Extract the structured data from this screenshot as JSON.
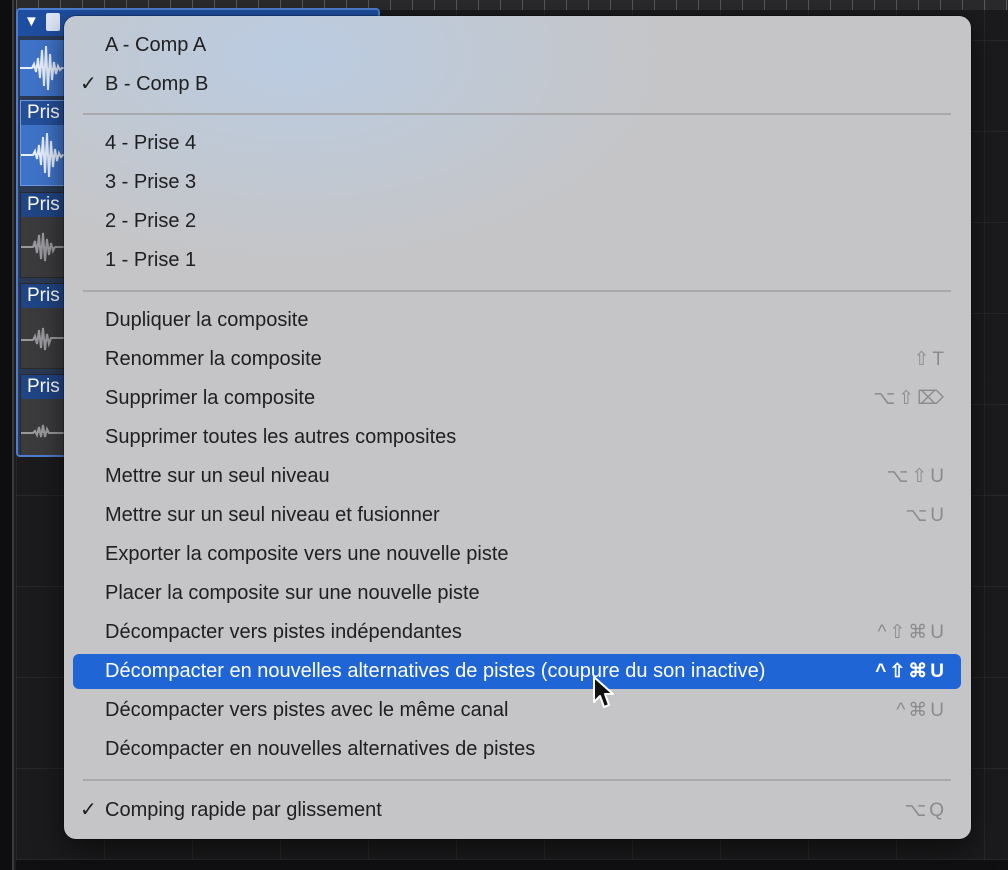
{
  "menu": {
    "items": [
      {
        "label": "A - Comp A",
        "checked": false,
        "shortcut": ""
      },
      {
        "label": "B - Comp B",
        "checked": true,
        "shortcut": ""
      },
      {
        "label": "4 - Prise 4",
        "checked": false,
        "shortcut": ""
      },
      {
        "label": "3 - Prise 3",
        "checked": false,
        "shortcut": ""
      },
      {
        "label": "2 - Prise 2",
        "checked": false,
        "shortcut": ""
      },
      {
        "label": "1 - Prise 1",
        "checked": false,
        "shortcut": ""
      },
      {
        "label": "Dupliquer la composite",
        "checked": false,
        "shortcut": ""
      },
      {
        "label": "Renommer la composite",
        "checked": false,
        "shortcut": "⇧T"
      },
      {
        "label": "Supprimer la composite",
        "checked": false,
        "shortcut": "⌥⇧⌦"
      },
      {
        "label": "Supprimer toutes les autres composites",
        "checked": false,
        "shortcut": ""
      },
      {
        "label": "Mettre sur un seul niveau",
        "checked": false,
        "shortcut": "⌥⇧U"
      },
      {
        "label": "Mettre sur un seul niveau et fusionner",
        "checked": false,
        "shortcut": "⌥U"
      },
      {
        "label": "Exporter la composite vers une nouvelle piste",
        "checked": false,
        "shortcut": ""
      },
      {
        "label": "Placer la composite sur une nouvelle piste",
        "checked": false,
        "shortcut": ""
      },
      {
        "label": "Décompacter vers pistes indépendantes",
        "checked": false,
        "shortcut": "^⇧⌘U"
      },
      {
        "label": "Décompacter en nouvelles alternatives de pistes (coupure du son inactive)",
        "checked": false,
        "shortcut": "^⇧⌘U",
        "highlighted": true
      },
      {
        "label": "Décompacter vers pistes avec le même canal",
        "checked": false,
        "shortcut": "^⌘U"
      },
      {
        "label": "Décompacter en nouvelles alternatives de pistes",
        "checked": false,
        "shortcut": ""
      },
      {
        "label": "Comping rapide par glissement",
        "checked": true,
        "shortcut": "⌥Q"
      }
    ],
    "check_glyph": "✓",
    "highlight_color": "#1f65d6"
  },
  "tracks": {
    "take_label": "Pris"
  }
}
